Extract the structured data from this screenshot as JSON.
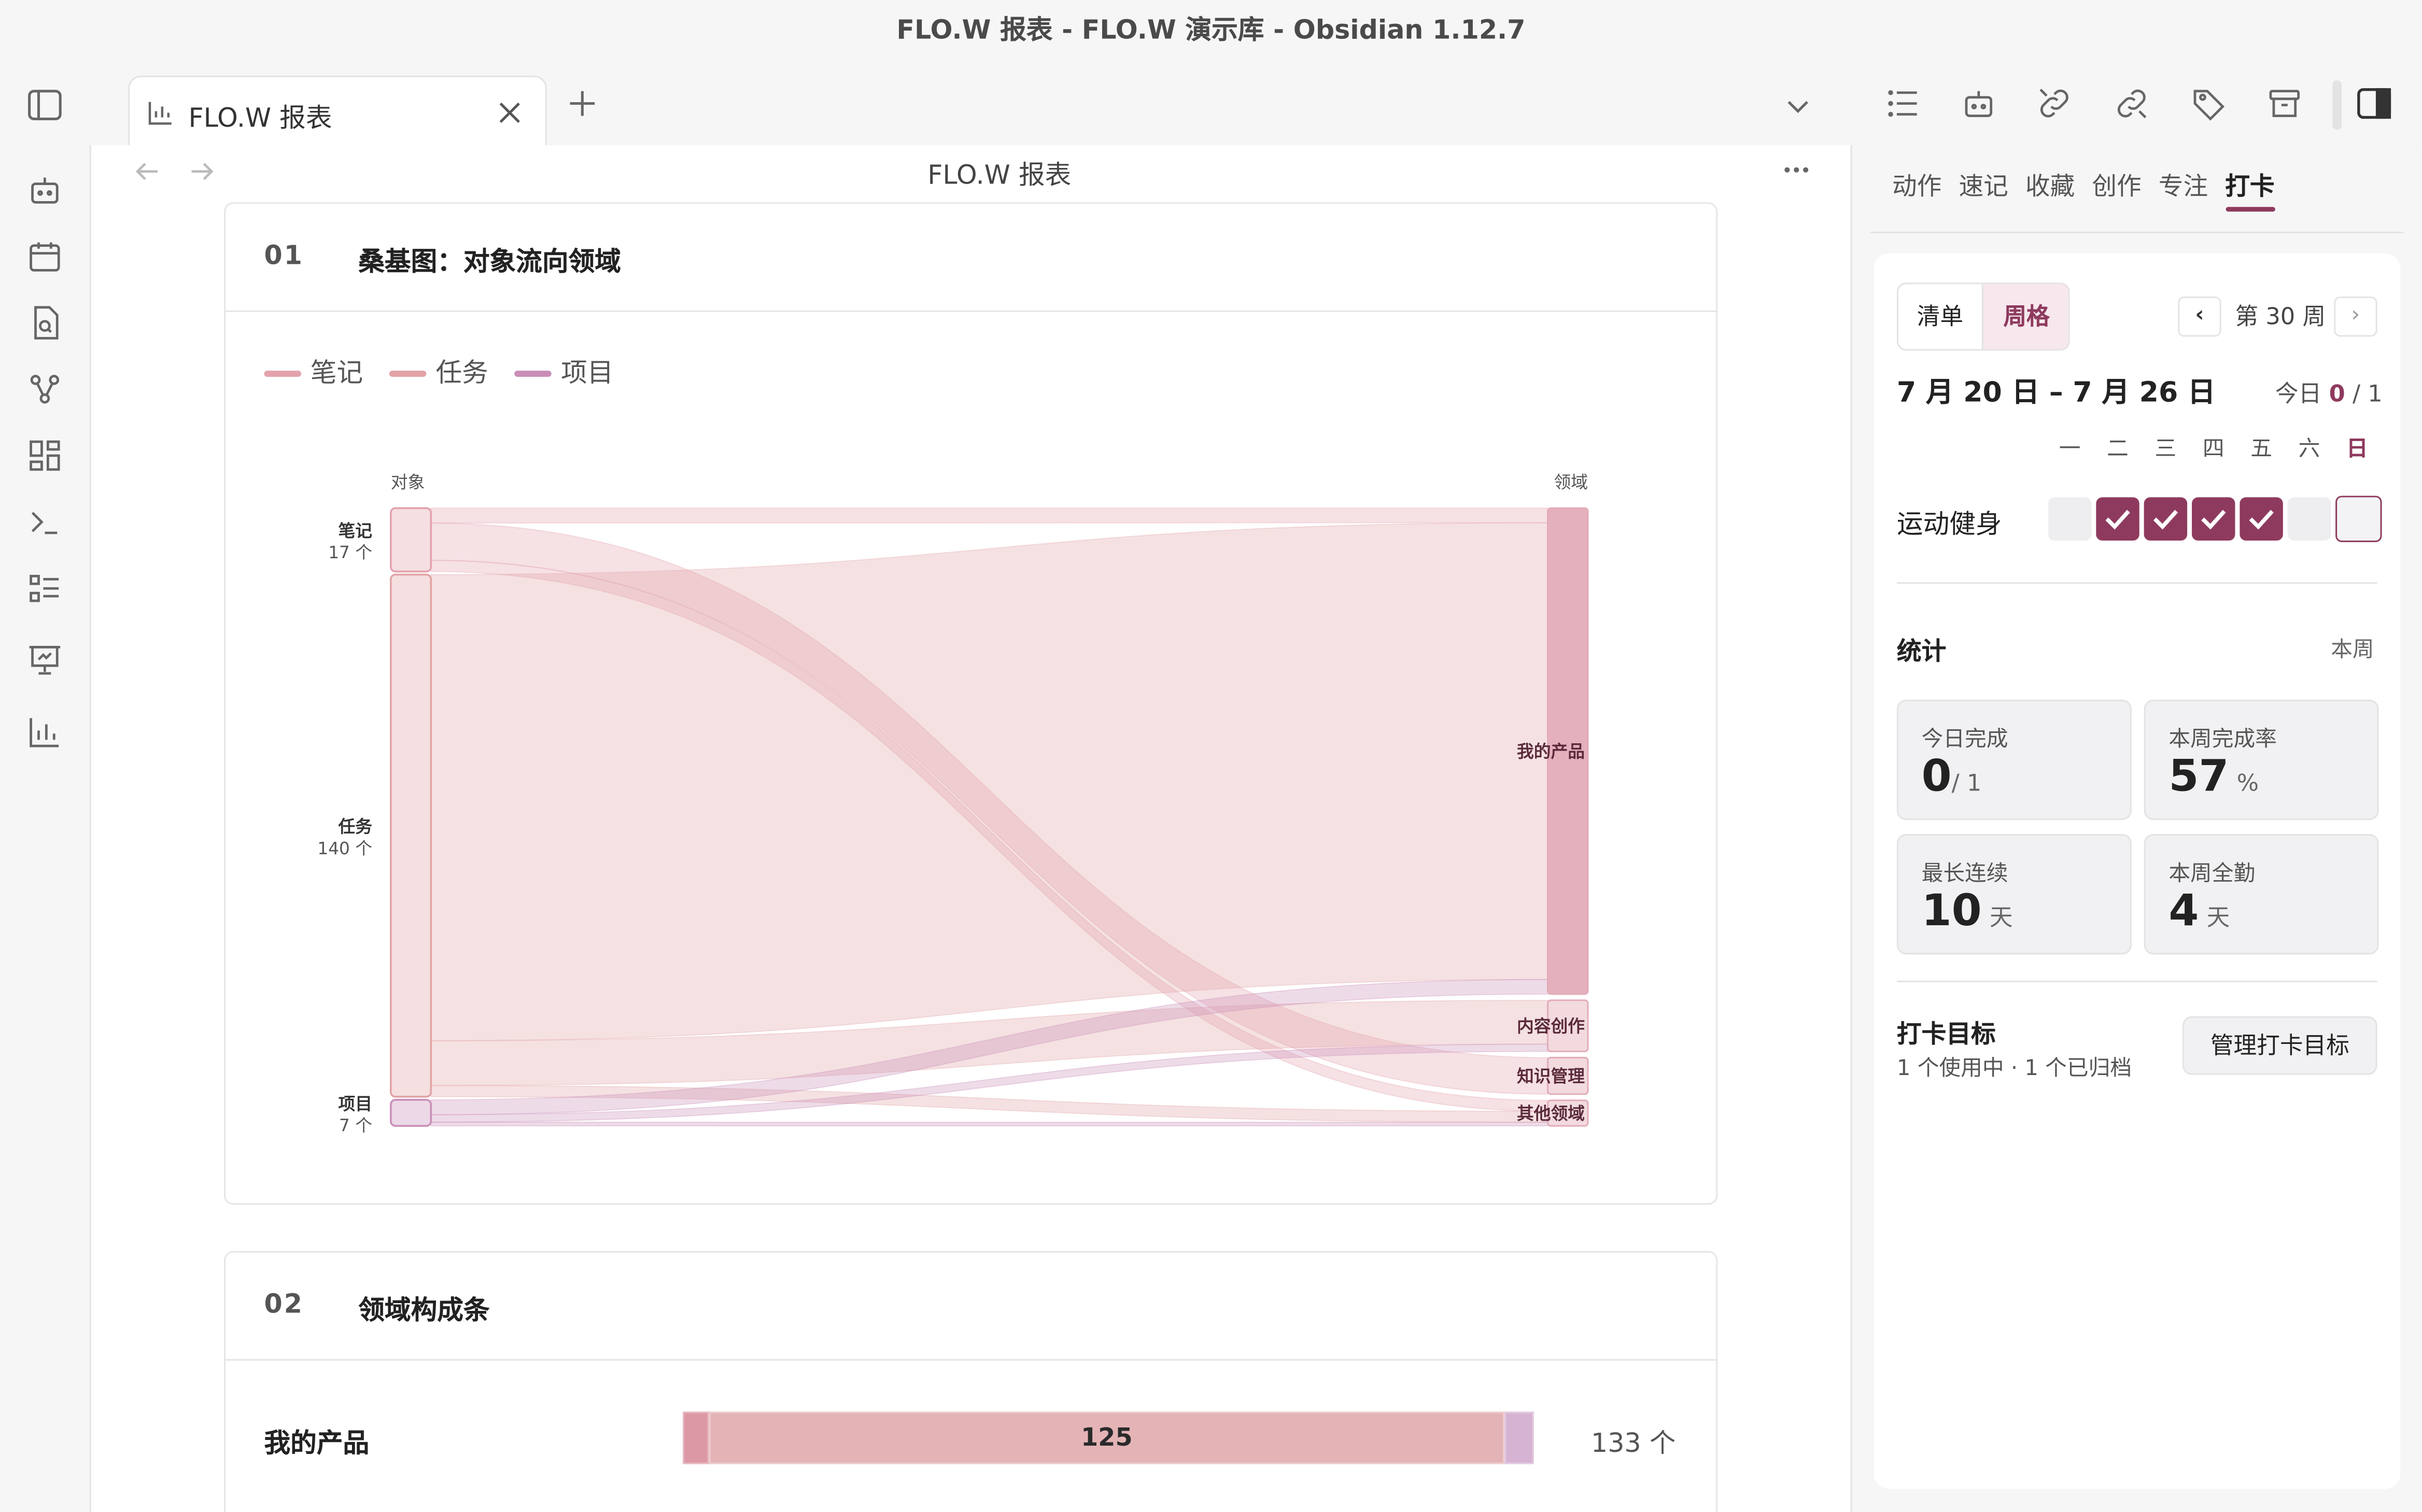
{
  "window": {
    "title": "FLO.W 报表 - FLO.W 演示库 - Obsidian 1.12.7"
  },
  "tabs": [
    {
      "label": "FLO.W 报表"
    }
  ],
  "note": {
    "title": "FLO.W 报表"
  },
  "sections": {
    "s1": {
      "num": "01",
      "title": "桑基图：对象流向领域",
      "legend": [
        {
          "label": "笔记",
          "color": "#e3a2ad"
        },
        {
          "label": "任务",
          "color": "#e1a3a5"
        },
        {
          "label": "项目",
          "color": "#c98eb7"
        }
      ]
    },
    "s2": {
      "num": "02",
      "title": "领域构成条",
      "row": {
        "label": "我的产品",
        "value": "125",
        "total": "133 个"
      }
    }
  },
  "chart_data": {
    "type": "sankey",
    "left_header": "对象",
    "right_header": "领域",
    "sources": [
      {
        "name": "笔记",
        "count": "17 个",
        "value": 17
      },
      {
        "name": "任务",
        "count": "140 个",
        "value": 140
      },
      {
        "name": "项目",
        "count": "7 个",
        "value": 7
      }
    ],
    "targets": [
      {
        "name": "我的产品",
        "value": 133
      },
      {
        "name": "内容创作",
        "value": 14
      },
      {
        "name": "知识管理",
        "value": 10
      },
      {
        "name": "其他领域",
        "value": 7
      }
    ],
    "links": [
      {
        "source": "笔记",
        "target": "我的产品",
        "value": 4
      },
      {
        "source": "笔记",
        "target": "知识管理",
        "value": 10
      },
      {
        "source": "笔记",
        "target": "其他领域",
        "value": 3
      },
      {
        "source": "任务",
        "target": "我的产品",
        "value": 125
      },
      {
        "source": "任务",
        "target": "内容创作",
        "value": 12
      },
      {
        "source": "任务",
        "target": "其他领域",
        "value": 3
      },
      {
        "source": "项目",
        "target": "我的产品",
        "value": 4
      },
      {
        "source": "项目",
        "target": "内容创作",
        "value": 2
      },
      {
        "source": "项目",
        "target": "其他领域",
        "value": 1
      }
    ],
    "colors": {
      "笔记": "#e3a2ad",
      "任务": "#e1a3a5",
      "项目": "#c98eb7",
      "target": "#e2acb8"
    }
  },
  "right_panel": {
    "tabs": [
      {
        "label": "动作"
      },
      {
        "label": "速记"
      },
      {
        "label": "收藏"
      },
      {
        "label": "创作"
      },
      {
        "label": "专注"
      },
      {
        "label": "打卡"
      }
    ],
    "active_tab": "打卡",
    "view_toggle": {
      "list": "清单",
      "grid": "周格",
      "active": "周格"
    },
    "week_label": "第 30 周",
    "date_range": "7 月 20 日 – 7 月 26 日",
    "today": {
      "prefix": "今日",
      "done": "0",
      "total": "/ 1"
    },
    "weekdays": [
      "一",
      "二",
      "三",
      "四",
      "五",
      "六",
      "日"
    ],
    "habit": {
      "name": "运动健身",
      "days": [
        false,
        true,
        true,
        true,
        true,
        false,
        false
      ]
    },
    "stats": {
      "title": "统计",
      "scope": "本周",
      "items": [
        {
          "label": "今日完成",
          "value": "0",
          "unit": "/ 1"
        },
        {
          "label": "本周完成率",
          "value": "57",
          "unit": "%"
        },
        {
          "label": "最长连续",
          "value": "10",
          "unit": "天"
        },
        {
          "label": "本周全勤",
          "value": "4",
          "unit": "天"
        }
      ]
    },
    "goals": {
      "title": "打卡目标",
      "subtitle": "1 个使用中 · 1 个已归档",
      "manage": "管理打卡目标"
    },
    "accent": "#8e3a5e"
  }
}
